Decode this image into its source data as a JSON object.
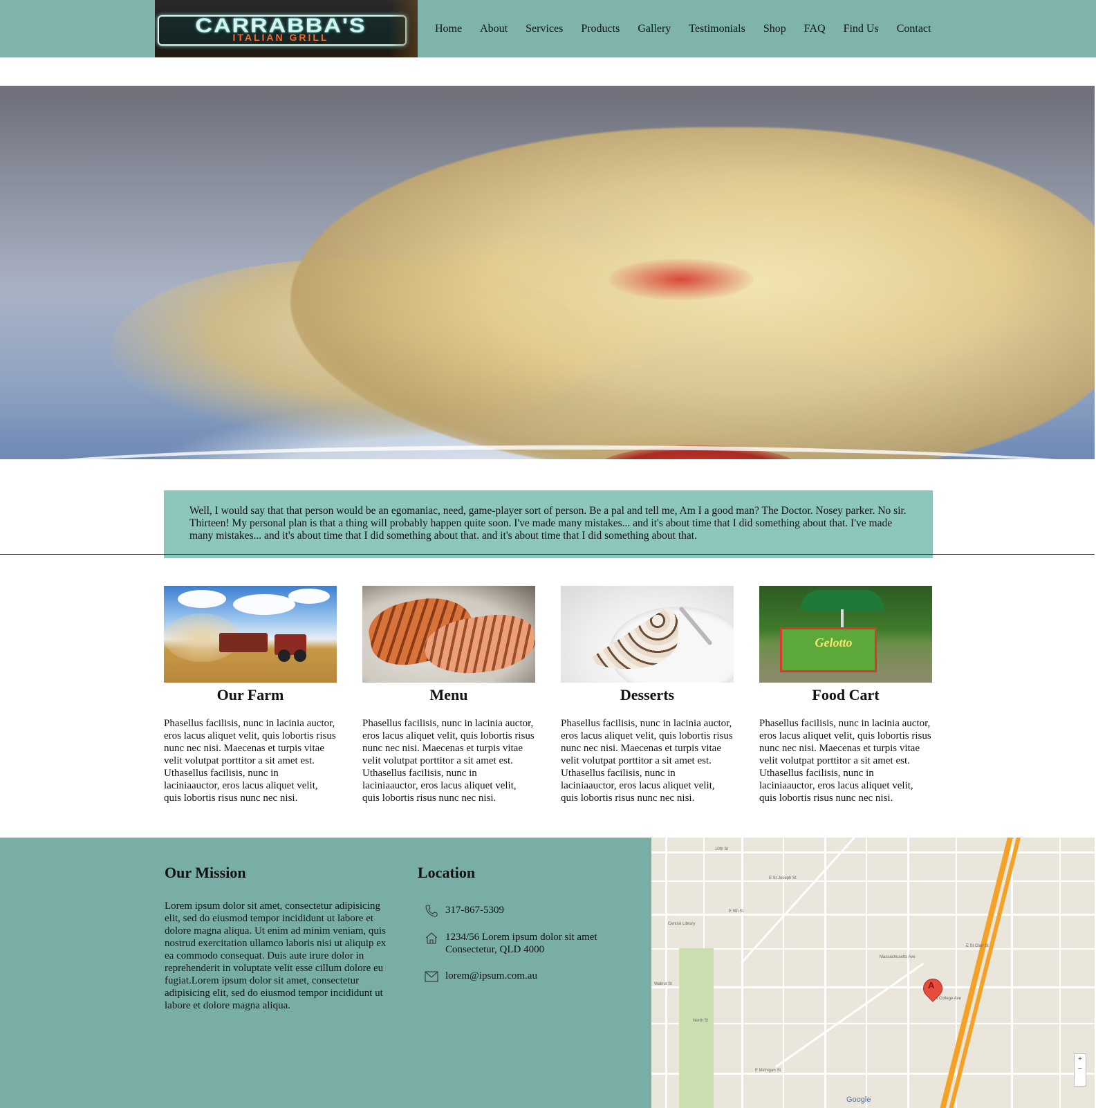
{
  "header": {
    "logo_brand": "CARRABBA'S",
    "logo_sub": "ITALIAN GRILL",
    "nav": [
      "Home",
      "About",
      "Services",
      "Products",
      "Gallery",
      "Testimonials",
      "Shop",
      "FAQ",
      "Find Us",
      "Contact"
    ]
  },
  "quote": {
    "text": "Well, I would say that that person would be an egomaniac, need, game-player sort of person. Be a pal and tell me, Am I a good man? The Doctor. Nosey parker. No sir. Thirteen! My personal plan is that a thing will probably happen quite soon. I've made many mistakes... and it's about time that I did something about that. I've made many mistakes... and it's about time that I did something about that. and it's about time that I did something about that."
  },
  "features": [
    {
      "title": "Our Farm",
      "text": "Phasellus facilisis, nunc in lacinia auctor, eros lacus aliquet velit, quis lobortis risus nunc nec nisi. Maecenas et turpis vitae velit volutpat porttitor a sit amet est. Uthasellus facilisis, nunc in laciniaauctor, eros lacus aliquet velit, quis lobortis risus nunc nec nisi."
    },
    {
      "title": "Menu",
      "text": "Phasellus facilisis, nunc in lacinia auctor, eros lacus aliquet velit, quis lobortis risus nunc nec nisi. Maecenas et turpis vitae velit volutpat porttitor a sit amet est. Uthasellus facilisis, nunc in laciniaauctor, eros lacus aliquet velit, quis lobortis risus nunc nec nisi."
    },
    {
      "title": "Desserts",
      "text": "Phasellus facilisis, nunc in lacinia auctor, eros lacus aliquet velit, quis lobortis risus nunc nec nisi. Maecenas et turpis vitae velit volutpat porttitor a sit amet est. Uthasellus facilisis, nunc in laciniaauctor, eros lacus aliquet velit, quis lobortis risus nunc nec nisi."
    },
    {
      "title": "Food Cart",
      "text": "Phasellus facilisis, nunc in lacinia auctor, eros lacus aliquet velit, quis lobortis risus nunc nec nisi. Maecenas et turpis vitae velit volutpat porttitor a sit amet est. Uthasellus facilisis, nunc in laciniaauctor, eros lacus aliquet velit, quis lobortis risus nunc nec nisi."
    }
  ],
  "cart_sign": "Gelotto",
  "footer": {
    "mission_title": "Our Mission",
    "mission_text": "Lorem ipsum dolor sit amet, consectetur adipisicing elit, sed do eiusmod tempor incididunt ut labore et dolore magna aliqua. Ut enim ad minim veniam, quis nostrud exercitation ullamco laboris nisi ut aliquip ex ea commodo consequat. Duis aute irure dolor in reprehenderit in voluptate velit esse cillum dolore eu fugiat.Lorem ipsum dolor sit amet, consectetur adipisicing elit, sed do eiusmod tempor incididunt ut labore et dolore magna aliqua.",
    "location_title": "Location",
    "phone": "317-867-5309",
    "address_line1": "1234/56 Lorem ipsum dolor sit amet",
    "address_line2": "Consectetur, QLD 4000",
    "email": "lorem@ipsum.com.au"
  },
  "map": {
    "pin_label": "A",
    "google": "Google",
    "zoom_in": "+",
    "zoom_out": "−",
    "streets": [
      "10th St",
      "E St Joseph St",
      "E 9th St",
      "Walnut St",
      "North St",
      "E Michigan St",
      "Massachusetts Ave",
      "N College Ave",
      "E St Clair St",
      "Central Library"
    ]
  },
  "colors": {
    "header_bg": "#7fb4ad",
    "quote_bg": "#8cc6bd",
    "footer_bg": "#79aea6"
  }
}
